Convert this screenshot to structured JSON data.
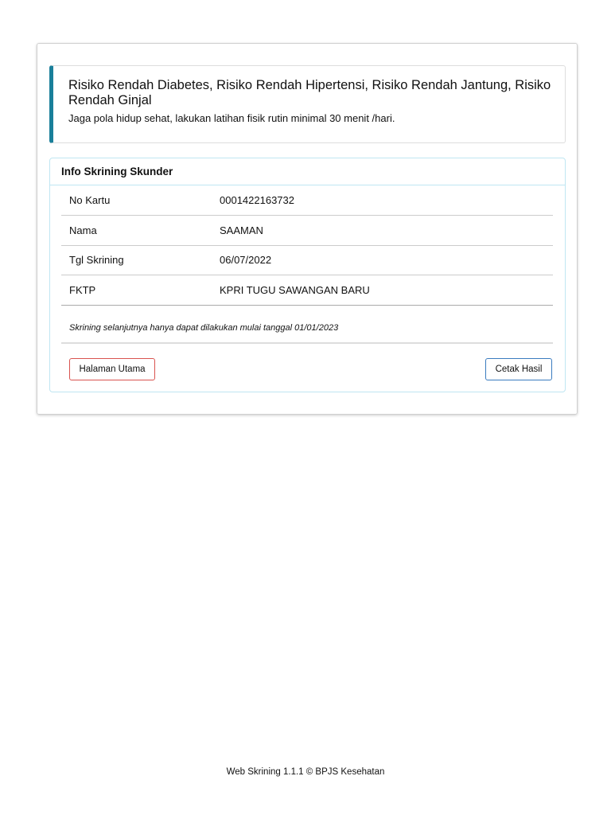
{
  "alert": {
    "title": "Risiko Rendah Diabetes, Risiko Rendah Hipertensi, Risiko Rendah Jantung, Risiko Rendah Ginjal",
    "message": "Jaga pola hidup sehat, lakukan latihan fisik rutin minimal 30 menit /hari."
  },
  "panel": {
    "title": "Info Skrining Skunder",
    "rows": [
      {
        "label": "No Kartu",
        "value": "0001422163732"
      },
      {
        "label": "Nama",
        "value": "SAAMAN"
      },
      {
        "label": "Tgl Skrining",
        "value": "06/07/2022"
      },
      {
        "label": "FKTP",
        "value": "KPRI TUGU SAWANGAN BARU"
      }
    ],
    "note": "Skrining selanjutnya hanya dapat dilakukan mulai tanggal 01/01/2023",
    "home_label": "Halaman Utama",
    "print_label": "Cetak Hasil"
  },
  "footer": "Web Skrining 1.1.1 © BPJS Kesehatan"
}
